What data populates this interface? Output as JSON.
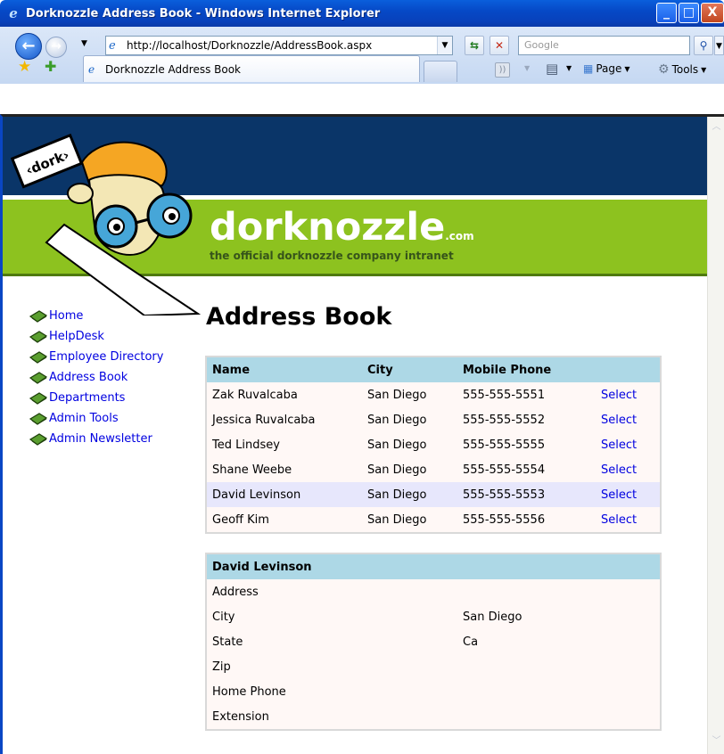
{
  "window": {
    "title": "Dorknozzle Address Book - Windows Internet Explorer",
    "min": "_",
    "max": "□",
    "close": "X"
  },
  "toolbar": {
    "url": "http://localhost/Dorknozzle/AddressBook.aspx",
    "search_placeholder": "Google",
    "tab_title": "Dorknozzle Address Book",
    "page_label": "Page",
    "tools_label": "Tools"
  },
  "header": {
    "brand": "dorknozzle",
    "brand_suffix": ".com",
    "tagline": "the official dorknozzle company intranet",
    "mascot_sign": "‹dork›"
  },
  "sidebar": {
    "items": [
      {
        "label": "Home"
      },
      {
        "label": "HelpDesk"
      },
      {
        "label": "Employee Directory"
      },
      {
        "label": "Address Book"
      },
      {
        "label": "Departments"
      },
      {
        "label": "Admin Tools"
      },
      {
        "label": "Admin Newsletter"
      }
    ]
  },
  "main": {
    "title": "Address Book",
    "grid": {
      "columns": [
        "Name",
        "City",
        "Mobile Phone",
        ""
      ],
      "rows": [
        {
          "name": "Zak Ruvalcaba",
          "city": "San Diego",
          "phone": "555-555-5551",
          "action": "Select"
        },
        {
          "name": "Jessica Ruvalcaba",
          "city": "San Diego",
          "phone": "555-555-5552",
          "action": "Select"
        },
        {
          "name": "Ted Lindsey",
          "city": "San Diego",
          "phone": "555-555-5555",
          "action": "Select"
        },
        {
          "name": "Shane Weebe",
          "city": "San Diego",
          "phone": "555-555-5554",
          "action": "Select"
        },
        {
          "name": "David Levinson",
          "city": "San Diego",
          "phone": "555-555-5553",
          "action": "Select"
        },
        {
          "name": "Geoff Kim",
          "city": "San Diego",
          "phone": "555-555-5556",
          "action": "Select"
        }
      ]
    },
    "detail": {
      "heading": "David Levinson",
      "fields": [
        {
          "label": "Address",
          "value": ""
        },
        {
          "label": "City",
          "value": "San Diego"
        },
        {
          "label": "State",
          "value": "Ca"
        },
        {
          "label": "Zip",
          "value": ""
        },
        {
          "label": "Home Phone",
          "value": ""
        },
        {
          "label": "Extension",
          "value": ""
        }
      ]
    }
  }
}
